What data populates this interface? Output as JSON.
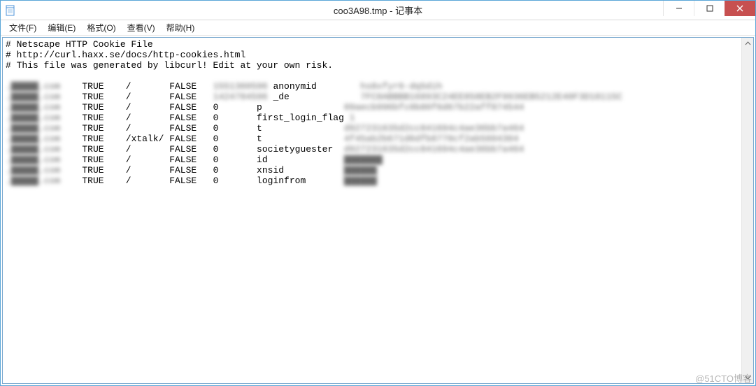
{
  "window": {
    "title": "coo3A98.tmp - 记事本",
    "app_icon": "notepad-icon"
  },
  "menubar": {
    "items": [
      "文件(F)",
      "编辑(E)",
      "格式(O)",
      "查看(V)",
      "帮助(H)"
    ]
  },
  "content": {
    "header_lines": [
      "# Netscape HTTP Cookie File",
      "# http://curl.haxx.se/docs/http-cookies.html",
      "# This file was generated by libcurl! Edit at your own risk."
    ],
    "rows": [
      {
        "domain": ".▇▇▇▇▇.com",
        "flag": "TRUE",
        "path": "/",
        "secure": "FALSE",
        "expiration": "1551360596",
        "name": "anonymid",
        "value": "hs8xfyr6-dq5dih"
      },
      {
        "domain": ".▇▇▇▇▇.com",
        "flag": "TRUE",
        "path": "/",
        "secure": "FALSE",
        "expiration": "1424784596",
        "name": "_de",
        "value": "7FC8ABBBB16893C24EE858EB2F9936EB5212E40F3D18115C"
      },
      {
        "domain": ".▇▇▇▇▇.com",
        "flag": "TRUE",
        "path": "/",
        "secure": "FALSE",
        "expiration": "0",
        "name": "p",
        "value": "09aecb996bfc0b80f6d67b22aff874544"
      },
      {
        "domain": ".▇▇▇▇▇.com",
        "flag": "TRUE",
        "path": "/",
        "secure": "FALSE",
        "expiration": "0",
        "name": "first_login_flag",
        "value": "1"
      },
      {
        "domain": ".▇▇▇▇▇.com",
        "flag": "TRUE",
        "path": "/",
        "secure": "FALSE",
        "expiration": "0",
        "name": "t",
        "value": "d927231635d2cc841694c4ae36bb7a464"
      },
      {
        "domain": ".▇▇▇▇▇.com",
        "flag": "TRUE",
        "path": "/xtalk/",
        "secure": "FALSE",
        "expiration": "0",
        "name": "t",
        "value": "4f45ab2b671d6dfb8770cf2ab5604304"
      },
      {
        "domain": ".▇▇▇▇▇.com",
        "flag": "TRUE",
        "path": "/",
        "secure": "FALSE",
        "expiration": "0",
        "name": "societyguester",
        "value": "d927231635d2cc841694c4ae36bb7a464"
      },
      {
        "domain": ".▇▇▇▇▇.com",
        "flag": "TRUE",
        "path": "/",
        "secure": "FALSE",
        "expiration": "0",
        "name": "id",
        "value": "▇▇▇▇▇▇▇"
      },
      {
        "domain": ".▇▇▇▇▇.com",
        "flag": "TRUE",
        "path": "/",
        "secure": "FALSE",
        "expiration": "0",
        "name": "xnsid",
        "value": "▇▇▇▇▇▇"
      },
      {
        "domain": ".▇▇▇▇▇.com",
        "flag": "TRUE",
        "path": "/",
        "secure": "FALSE",
        "expiration": "0",
        "name": "loginfrom",
        "value": "▇▇▇▇▇▇"
      }
    ],
    "blurred_domain_indices": [
      0,
      1,
      2,
      3,
      4,
      5,
      6,
      7,
      8,
      9
    ],
    "blurred_value_indices": [
      0,
      1,
      2,
      3,
      4,
      5,
      6,
      7,
      8,
      9
    ],
    "blurred_exp_indices": [
      0,
      1
    ],
    "col_widths": {
      "domain": 14,
      "flag": 8,
      "path": 8,
      "secure": 8,
      "expiration": 8,
      "name": 16
    }
  },
  "watermark": "@51CTO博客"
}
